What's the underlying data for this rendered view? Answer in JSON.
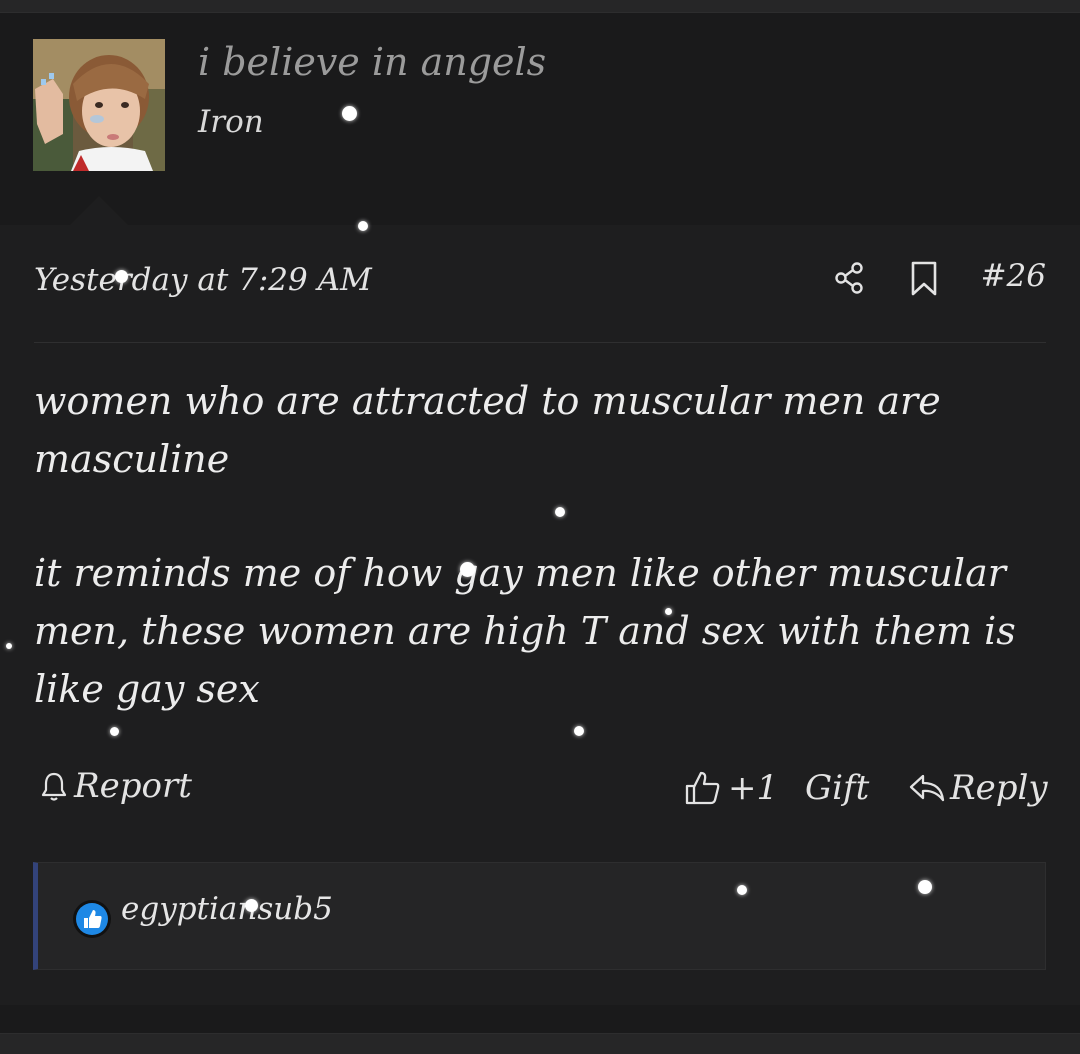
{
  "user": {
    "username": "i believe in angels",
    "rank": "Iron"
  },
  "post": {
    "timestamp": "Yesterday at 7:29 AM",
    "number": "#26",
    "paragraphs": [
      "women who are attracted to muscular men are masculine",
      "it reminds me of how gay men like other muscular men, these women are high T and sex with them is like gay sex"
    ]
  },
  "actions": {
    "report": "Report",
    "like_count": "+1",
    "gift": "Gift",
    "reply": "Reply"
  },
  "reactions": {
    "user": "egyptiansub5",
    "icon": "thumbs-up-icon"
  },
  "colors": {
    "background": "#1e1e1f",
    "header_band": "#1a1a1b",
    "reaction_accent": "#33437a",
    "reaction_icon": "#1e88e5"
  }
}
